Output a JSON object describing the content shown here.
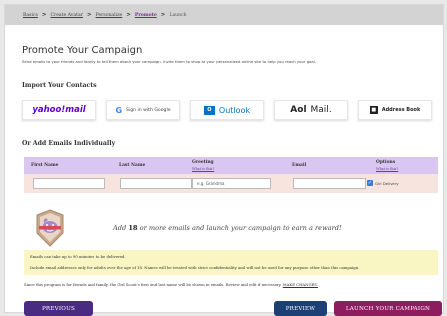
{
  "breadcrumb": {
    "items": [
      {
        "label": "Basics",
        "state": "link"
      },
      {
        "label": "Create Avatar",
        "state": "link"
      },
      {
        "label": "Personalize",
        "state": "link"
      },
      {
        "label": "Promote",
        "state": "current"
      },
      {
        "label": "Launch",
        "state": "plain"
      }
    ],
    "separator": ">"
  },
  "header": {
    "title": "Promote Your Campaign",
    "subtitle": "Send emails to your friends and family to tell them about your campaign. Invite them to shop at your personalized online site to help you reach your goal."
  },
  "import": {
    "heading": "Import Your Contacts",
    "providers": {
      "yahoo": "yahoo!mail",
      "google_icon": "G",
      "google": "Sign in with Google",
      "outlook_icon": "O",
      "outlook": "Outlook",
      "aol_brand": "Aol",
      "aol_mail": "Mail.",
      "addressbook_icon": "■",
      "addressbook": "Address Book"
    }
  },
  "add_emails": {
    "heading": "Or Add Emails Individually",
    "columns": {
      "first_name": "First Name",
      "last_name": "Last Name",
      "greeting": "Greeting",
      "greeting_link": "What is this?",
      "email": "Email",
      "options": "Options",
      "options_link": "What is this?"
    },
    "row": {
      "first_name": "",
      "last_name": "",
      "greeting_placeholder": "e.g. Grandma",
      "email": "",
      "gift_delivery_checked": true,
      "gift_delivery_label": "Girl Delivery"
    }
  },
  "reward": {
    "prefix": "Add",
    "count": "18",
    "suffix": "or more emails and launch your campaign to earn a reward!"
  },
  "notice": {
    "line1": "Emails can take up to 90 minutes to be delivered.",
    "line2": "Include email addresses only for adults over the age of 18. Names will be treated with strict confidentiality and will not be used for any purpose other than this campaign."
  },
  "share_note": {
    "text": "Since this program is for friends and family, the Girl Scout's first and last name will be shown in emails. Review and edit if necessary.",
    "link": "MAKE CHANGES."
  },
  "buttons": {
    "previous": "PREVIOUS",
    "preview": "PREVIEW",
    "launch": "LAUNCH YOUR CAMPAIGN"
  },
  "colors": {
    "purple": "#4a2b82",
    "navy": "#1c3f75",
    "magenta": "#8e1d5f",
    "lavender": "#d9c7f2",
    "pale_yellow": "#faf6c4"
  }
}
